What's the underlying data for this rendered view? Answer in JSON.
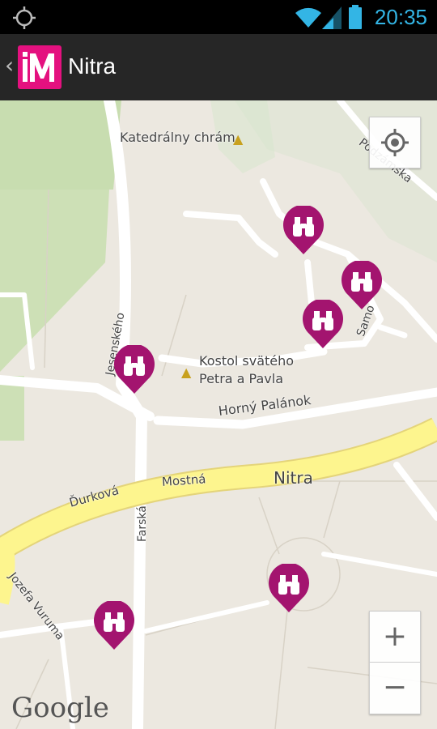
{
  "status_bar": {
    "time": "20:35",
    "icons": [
      "gps-icon",
      "wifi-icon",
      "signal-icon",
      "battery-icon"
    ],
    "accent_color": "#33B5E5"
  },
  "action_bar": {
    "title": "Nitra",
    "logo_text": "iM",
    "logo_color": "#E4117F",
    "up_icon": "chevron-left-icon"
  },
  "map": {
    "labels": {
      "cathedral": "Katedrálny chrám",
      "church_line1": "Kostol svätého",
      "church_line2": "Petra a Pavla",
      "horny_palanok": "Horný Palánok",
      "nitra_street": "Nitra",
      "mostna": "Mostná",
      "durkova": "Ďurková",
      "farska": "Farská",
      "jesenskeho": "Jesenského",
      "jozefa_vuruma": "Jozefa Vuruma",
      "podzamska": "Podzámska",
      "samova": "Samo"
    },
    "markers_icon": "binoculars-icon",
    "marker_color": "#A3146F",
    "attribution": "Google"
  },
  "controls": {
    "my_location_icon": "my-location-icon",
    "zoom_in": "+",
    "zoom_out": "−"
  }
}
